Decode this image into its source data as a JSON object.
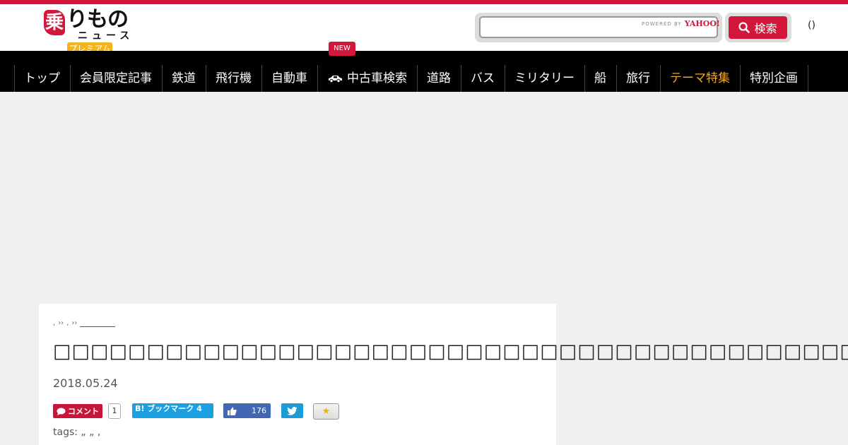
{
  "header": {
    "logo_kanji": "乗",
    "logo_main": "りもの",
    "logo_sub": "ニュース",
    "premium_label": "プレミアム",
    "search_placeholder": "",
    "powered_by": "POWERED BY",
    "yahoo_label": "YAHOO!",
    "search_button_label": "検索",
    "user_label": "()"
  },
  "nav": {
    "new_badge": "NEW",
    "items": [
      {
        "label": "トップ"
      },
      {
        "label": "会員限定記事"
      },
      {
        "label": "鉄道"
      },
      {
        "label": "飛行機"
      },
      {
        "label": "自動車"
      },
      {
        "label": "中古車検索"
      },
      {
        "label": "道路"
      },
      {
        "label": "バス"
      },
      {
        "label": "ミリタリー"
      },
      {
        "label": "船"
      },
      {
        "label": "旅行"
      },
      {
        "label": "テーマ特集"
      },
      {
        "label": "特別企画"
      }
    ],
    "theme_color": "#f5a623"
  },
  "article": {
    "breadcrumb": [
      ",",
      "››",
      ",",
      "››"
    ],
    "title": "□□□□□□□□□□□□□□□□□□□□□□□□□□□□□□□□□□□□□□□□□□□",
    "date": "2018.05.24",
    "share": {
      "comment_label": "コメント",
      "comment_count": "1",
      "hatena_label": "B! ブックマーク",
      "hatena_count": "4",
      "like_count": "176"
    },
    "tags": "tags: „ „ ,"
  },
  "colors": {
    "brand": "#d2173a",
    "premium": "#f3b51c",
    "hatena": "#1ba0e1",
    "facebook": "#4267b2",
    "twitter": "#1d9bd7"
  }
}
